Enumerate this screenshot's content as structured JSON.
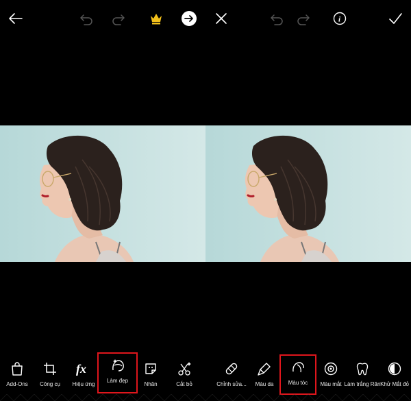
{
  "left_toolbar": [
    {
      "label": "Add-Ons",
      "icon": "shopping-bag-icon"
    },
    {
      "label": "Công cụ",
      "icon": "crop-icon"
    },
    {
      "label": "Hiệu ứng",
      "icon": "fx-icon"
    },
    {
      "label": "Làm đẹp",
      "icon": "beautify-face-icon",
      "highlighted": true
    },
    {
      "label": "Nhãn",
      "icon": "sticker-icon"
    },
    {
      "label": "Cắt bỏ",
      "icon": "cutout-scissors-icon"
    }
  ],
  "right_toolbar": [
    {
      "label": "Chỉnh sửa...",
      "icon": "bandage-icon"
    },
    {
      "label": "Màu da",
      "icon": "skin-tone-brush-icon"
    },
    {
      "label": "Màu tóc",
      "icon": "hair-color-icon",
      "highlighted": true
    },
    {
      "label": "Màu mắt",
      "icon": "eye-color-icon"
    },
    {
      "label": "Làm trắng Răn",
      "icon": "tooth-icon"
    },
    {
      "label": "Khử Mắt đỏ",
      "icon": "red-eye-removal-icon"
    }
  ],
  "colors": {
    "highlight": "#e0161c",
    "crown": "#f2c01b",
    "background": "#000000",
    "photo_background": "#c9e3e2"
  }
}
